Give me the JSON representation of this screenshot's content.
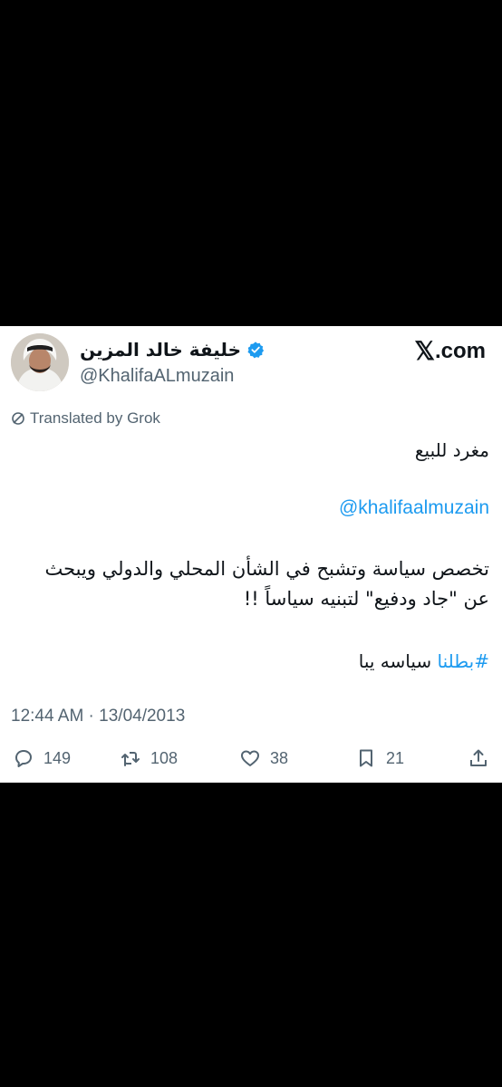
{
  "tweet": {
    "display_name": "خليفة خالد المزين",
    "handle": "@KhalifaALmuzain",
    "brand": ".com",
    "translated_label": "Translated by Grok",
    "lines": [
      "مغرد للبيع",
      "@khalifaalmuzain",
      "تخصص سياسة وتشبح في الشأن المحلي والدولي ويبحث",
      "عن \"جاد ودفيع\" لتبنيه سياساً !!"
    ],
    "hashtag": "#بطلنا",
    "hashtag_rest": "سياسه يبا",
    "timestamp": "12:44 AM · 13/04/2013"
  },
  "actions": {
    "replies": "149",
    "reposts": "108",
    "likes": "38",
    "bookmarks": "21"
  },
  "colors": {
    "background": "#000000",
    "card": "#ffffff",
    "text": "#0f1419",
    "secondary": "#536471",
    "accent": "#1d9bf0"
  }
}
